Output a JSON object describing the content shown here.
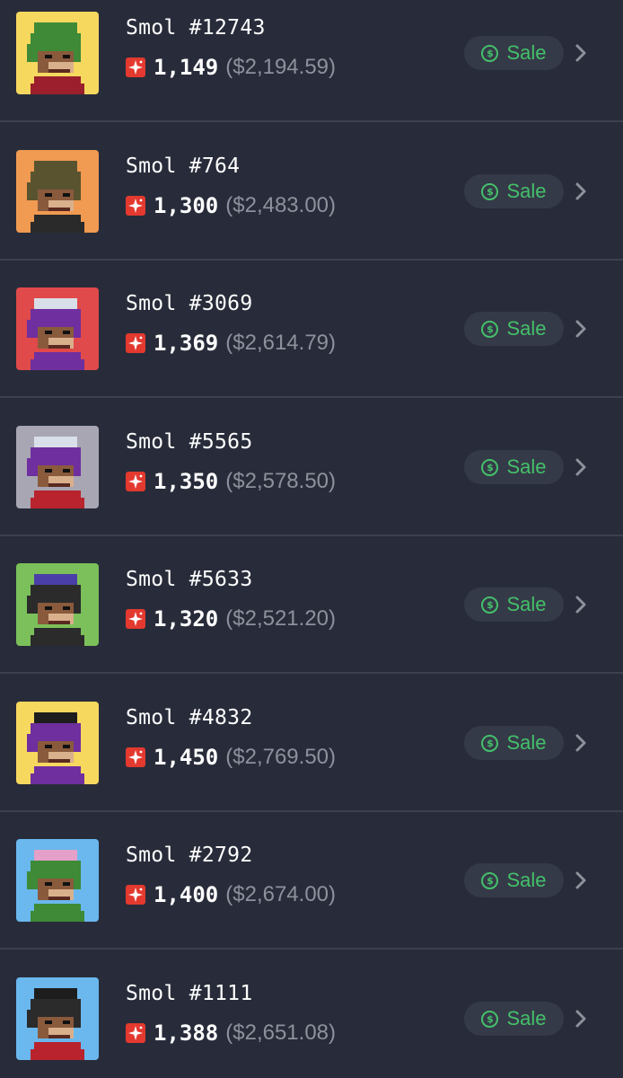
{
  "theme": {
    "background": "#282c3a",
    "divider": "#3c414f",
    "sale_color": "#44c06a",
    "magic_icon_color": "#e3392f",
    "usd_color": "#8d919c"
  },
  "items": [
    {
      "name": "Smol #12743",
      "price": "1,149",
      "usd": "($2,194.59)",
      "sale_label": "Sale",
      "bg": "#f7d85f",
      "hair": "#3e8a37",
      "hat": "#3e8a37",
      "shirt": "#9b1f2c"
    },
    {
      "name": "Smol #764",
      "price": "1,300",
      "usd": "($2,483.00)",
      "sale_label": "Sale",
      "bg": "#f09a52",
      "hair": "#59542f",
      "hat": "#59542f",
      "shirt": "#2a2a2a"
    },
    {
      "name": "Smol #3069",
      "price": "1,369",
      "usd": "($2,614.79)",
      "sale_label": "Sale",
      "bg": "#e04a4a",
      "hair": "#6f2f9f",
      "hat": "#d9dfe8",
      "shirt": "#6f2f9f"
    },
    {
      "name": "Smol #5565",
      "price": "1,350",
      "usd": "($2,578.50)",
      "sale_label": "Sale",
      "bg": "#a8a6b2",
      "hair": "#6f2f9f",
      "hat": "#d9dfe8",
      "shirt": "#b8232d"
    },
    {
      "name": "Smol #5633",
      "price": "1,320",
      "usd": "($2,521.20)",
      "sale_label": "Sale",
      "bg": "#7bc05a",
      "hair": "#2b2b2b",
      "hat": "#4a3fa8",
      "shirt": "#2b2b2b"
    },
    {
      "name": "Smol #4832",
      "price": "1,450",
      "usd": "($2,769.50)",
      "sale_label": "Sale",
      "bg": "#f7d85f",
      "hair": "#6f2f9f",
      "hat": "#1d1d1d",
      "shirt": "#6f2f9f"
    },
    {
      "name": "Smol #2792",
      "price": "1,400",
      "usd": "($2,674.00)",
      "sale_label": "Sale",
      "bg": "#6ab8ee",
      "hair": "#3e8a37",
      "hat": "#e4a0c8",
      "shirt": "#3e8a37"
    },
    {
      "name": "Smol #1111",
      "price": "1,388",
      "usd": "($2,651.08)",
      "sale_label": "Sale",
      "bg": "#6ab8ee",
      "hair": "#2b2b2b",
      "hat": "#1d1d1d",
      "shirt": "#b8232d"
    }
  ],
  "icons": {
    "currency": "magic-sparkle-icon",
    "sale": "dollar-circle-icon",
    "chevron": "chevron-right-icon"
  }
}
